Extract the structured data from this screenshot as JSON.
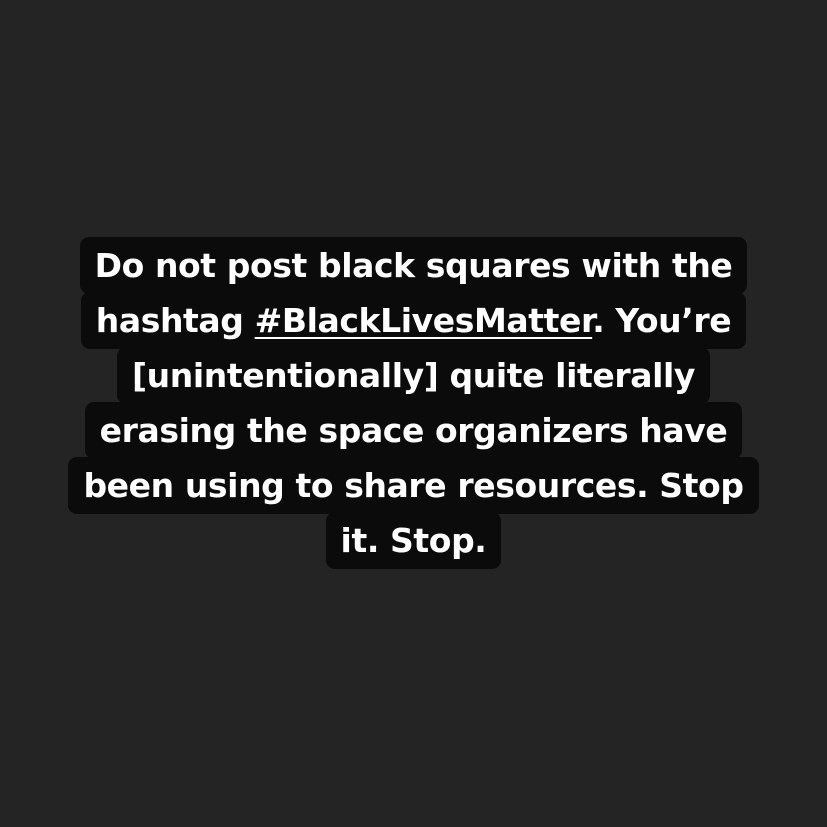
{
  "colors": {
    "background": "#242424",
    "text_highlight": "#0b0b0b",
    "text": "#ffffff"
  },
  "story": {
    "line1": "Do not post black squares with the",
    "line2_before": "hashtag ",
    "hashtag": "#BlackLivesMatter",
    "line2_after": ". You’re",
    "line3": "[unintentionally] quite literally",
    "line4": "erasing the space organizers have",
    "line5": "been using to share resources. Stop",
    "line6": "it. Stop."
  }
}
